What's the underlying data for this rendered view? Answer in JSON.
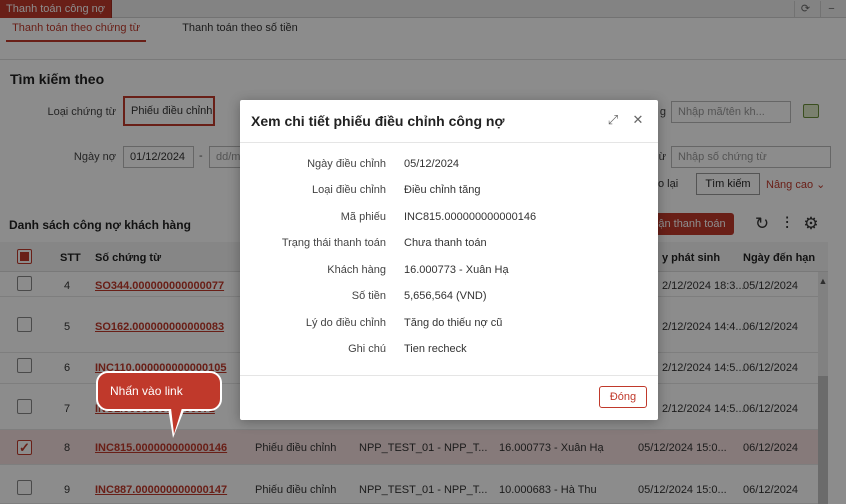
{
  "window": {
    "tab_title": "Thanh toán công nợ",
    "refresh_icon": "refresh-icon",
    "minimize_icon": "minimize-icon"
  },
  "tabs": [
    {
      "label": "Thanh toán theo chứng từ",
      "active": true
    },
    {
      "label": "Thanh toán theo số tiền",
      "active": false
    }
  ],
  "search": {
    "title": "Tìm kiếm theo",
    "doc_type_label": "Loại chứng từ",
    "doc_type_value": "Phiếu điều chỉnh",
    "date_label": "Ngày nợ",
    "date_from": "01/12/2024",
    "date_separator": "-",
    "date_to_placeholder": "dd/m",
    "right_label_1": "g",
    "code_placeholder": "Nhập mã/tên kh...",
    "right_label_2": "ừ",
    "doc_no_placeholder": "Nhập số chứng từ",
    "reset_label": "o lại",
    "search_button": "Tìm kiếm",
    "advanced_label": "Nâng cao"
  },
  "list": {
    "title": "Danh sách công nợ khách hàng",
    "pay_button": "ận thanh toán",
    "columns": {
      "stt": "STT",
      "doc_no": "Số chứng từ",
      "created": "y phát sinh",
      "due": "Ngày đến hạn"
    },
    "rows": [
      {
        "stt": "4",
        "doc_no": "SO344.000000000000077",
        "type": "",
        "npp": "",
        "customer": "",
        "created": "2/12/2024 18:3...",
        "due": "05/12/2024",
        "checked": false,
        "selected": false
      },
      {
        "stt": "5",
        "doc_no": "SO162.000000000000083",
        "type": "",
        "npp": "",
        "customer": "",
        "created": "2/12/2024 14:4...",
        "due": "06/12/2024",
        "checked": false,
        "selected": false
      },
      {
        "stt": "6",
        "doc_no": "INC110.000000000000105",
        "type": "",
        "npp": "",
        "customer": "",
        "created": "2/12/2024 14:5...",
        "due": "06/12/2024",
        "checked": false,
        "selected": false
      },
      {
        "stt": "7",
        "doc_no": "INC1.000000000000071",
        "type": "",
        "npp": "",
        "customer": "",
        "created": "2/12/2024 14:5...",
        "due": "06/12/2024",
        "checked": false,
        "selected": false
      },
      {
        "stt": "8",
        "doc_no": "INC815.000000000000146",
        "type": "Phiếu điều chỉnh",
        "npp": "NPP_TEST_01 - NPP_T...",
        "customer": "16.000773 - Xuân Hạ",
        "created": "05/12/2024 15:0...",
        "due": "06/12/2024",
        "checked": true,
        "selected": true
      },
      {
        "stt": "9",
        "doc_no": "INC887.000000000000147",
        "type": "Phiếu điều chỉnh",
        "npp": "NPP_TEST_01 - NPP_T...",
        "customer": "10.000683 - Hà Thu",
        "created": "05/12/2024 15:0...",
        "due": "06/12/2024",
        "checked": false,
        "selected": false
      }
    ]
  },
  "callout": {
    "text": "Nhấn vào link"
  },
  "modal": {
    "title": "Xem chi tiết phiếu điều chỉnh công nợ",
    "expand_icon": "expand-icon",
    "close_icon": "close-icon",
    "fields": [
      {
        "label": "Ngày điều chỉnh",
        "value": "05/12/2024"
      },
      {
        "label": "Loại điều chỉnh",
        "value": "Điều chỉnh tăng"
      },
      {
        "label": "Mã phiếu",
        "value": "INC815.000000000000146"
      },
      {
        "label": "Trạng thái thanh toán",
        "value": "Chưa thanh toán"
      },
      {
        "label": "Khách hàng",
        "value": "16.000773 - Xuân Hạ"
      },
      {
        "label": "Số tiền",
        "value": "5,656,564 (VND)"
      },
      {
        "label": "Lý do điều chỉnh",
        "value": "Tăng do thiếu nợ cũ"
      },
      {
        "label": "Ghi chú",
        "value": "Tien recheck"
      }
    ],
    "close_button": "Đóng"
  },
  "colors": {
    "accent": "#c0392b",
    "selected_row": "#f5dede"
  }
}
